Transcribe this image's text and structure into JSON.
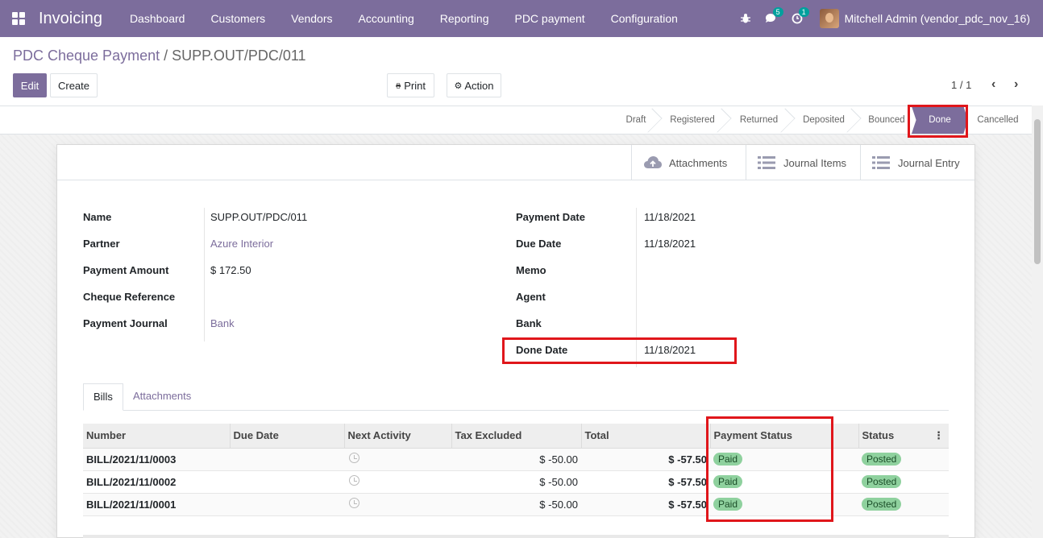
{
  "navbar": {
    "brand": "Invoicing",
    "menu": [
      "Dashboard",
      "Customers",
      "Vendors",
      "Accounting",
      "Reporting",
      "PDC payment",
      "Configuration"
    ],
    "messages_count": "5",
    "activities_count": "1",
    "user": "Mitchell Admin (vendor_pdc_nov_16)"
  },
  "breadcrumb": {
    "parent": "PDC Cheque Payment",
    "separator": "/",
    "current": "SUPP.OUT/PDC/011"
  },
  "buttons": {
    "edit": "Edit",
    "create": "Create",
    "print": "Print",
    "action": "Action"
  },
  "pager": {
    "value": "1 / 1"
  },
  "stages": [
    {
      "label": "Draft"
    },
    {
      "label": "Registered"
    },
    {
      "label": "Returned"
    },
    {
      "label": "Deposited"
    },
    {
      "label": "Bounced"
    },
    {
      "label": "Done",
      "active": true
    },
    {
      "label": "Cancelled"
    }
  ],
  "smart_buttons": {
    "attachments": "Attachments",
    "journal_items": "Journal Items",
    "journal_entry": "Journal Entry"
  },
  "form": {
    "left": [
      {
        "label": "Name",
        "value": "SUPP.OUT/PDC/011"
      },
      {
        "label": "Partner",
        "value": "Azure Interior"
      },
      {
        "label": "Payment Amount",
        "value": "$ 172.50"
      },
      {
        "label": "Cheque Reference",
        "value": ""
      },
      {
        "label": "Payment Journal",
        "value": "Bank"
      }
    ],
    "right": [
      {
        "label": "Payment Date",
        "value": "11/18/2021"
      },
      {
        "label": "Due Date",
        "value": "11/18/2021"
      },
      {
        "label": "Memo",
        "value": ""
      },
      {
        "label": "Agent",
        "value": ""
      },
      {
        "label": "Bank",
        "value": ""
      },
      {
        "label": "Done Date",
        "value": "11/18/2021"
      }
    ]
  },
  "tabs": {
    "bills": "Bills",
    "attachments": "Attachments"
  },
  "table": {
    "headers": {
      "number": "Number",
      "due_date": "Due Date",
      "next_activity": "Next Activity",
      "tax_excluded": "Tax Excluded",
      "total": "Total",
      "payment_status": "Payment Status",
      "status": "Status"
    },
    "rows": [
      {
        "number": "BILL/2021/11/0003",
        "due_date": "",
        "tax_excluded": "$ -50.00",
        "total": "$ -57.50",
        "payment_status": "Paid",
        "status": "Posted"
      },
      {
        "number": "BILL/2021/11/0002",
        "due_date": "",
        "tax_excluded": "$ -50.00",
        "total": "$ -57.50",
        "payment_status": "Paid",
        "status": "Posted"
      },
      {
        "number": "BILL/2021/11/0001",
        "due_date": "",
        "tax_excluded": "$ -50.00",
        "total": "$ -57.50",
        "payment_status": "Paid",
        "status": "Posted"
      }
    ]
  },
  "colors": {
    "brand": "#7c6d9c",
    "highlight": "#e0161b",
    "badge": "#00a09d",
    "pill": "#8fd19e"
  }
}
